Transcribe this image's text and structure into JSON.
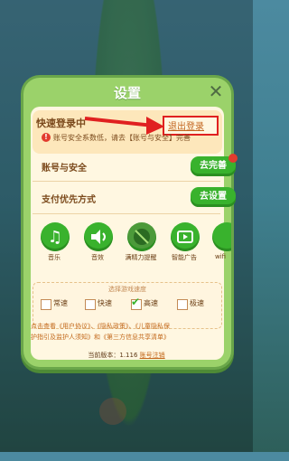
{
  "panel": {
    "title": "设置"
  },
  "quick_login": {
    "label": "快速登录中",
    "logout": "退出登录"
  },
  "warning": {
    "text": "账号安全系数低，请去【账号与安全】完善"
  },
  "rows": [
    {
      "label": "账号与安全",
      "button": "去完善"
    },
    {
      "label": "支付优先方式",
      "button": "去设置"
    }
  ],
  "features": [
    {
      "label": "音乐",
      "icon": "music-icon"
    },
    {
      "label": "音效",
      "icon": "sound-icon"
    },
    {
      "label": "满精力提醒",
      "icon": "no-disturb-icon"
    },
    {
      "label": "智能广告",
      "icon": "video-play-icon"
    },
    {
      "label": "wifi",
      "icon": "wifi-icon"
    }
  ],
  "speed": {
    "title": "选择游戏速度",
    "options": [
      "常速",
      "快速",
      "高速",
      "极速"
    ],
    "selected": "高速"
  },
  "legal": {
    "line1": "点击查看《用户协议》、《隐私政策》、《儿童隐私保",
    "line2": "护指引及监护人须知》和《第三方信息共享清单》"
  },
  "version": {
    "label": "当前版本：1.116",
    "account_link": "账号注销"
  },
  "colors": {
    "accent_green": "#39b22d",
    "highlight_red": "#e02020",
    "text_brown": "#7b4a1c"
  }
}
